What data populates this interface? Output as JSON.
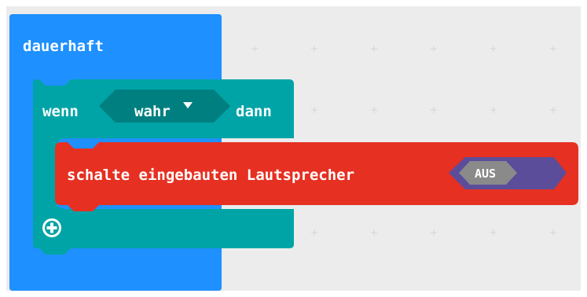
{
  "blocks": {
    "forever": {
      "label": "dauerhaft"
    },
    "if_then": {
      "if_label": "wenn",
      "then_label": "dann"
    },
    "condition": {
      "value": "wahr"
    },
    "speaker": {
      "label": "schalte eingebauten Lautsprecher"
    },
    "toggle": {
      "value": "AUS"
    }
  },
  "colors": {
    "workspace_bg": "#ececec",
    "forever_block": "#1e90ff",
    "if_block": "#00a4a6",
    "condition_bg": "#007f80",
    "speaker_block": "#e63022",
    "toggle_dark": "#5c4d9a",
    "toggle_light": "#8a8a8a"
  },
  "icons": {
    "dropdown": "caret-down-icon",
    "add": "plus-circle-icon"
  }
}
